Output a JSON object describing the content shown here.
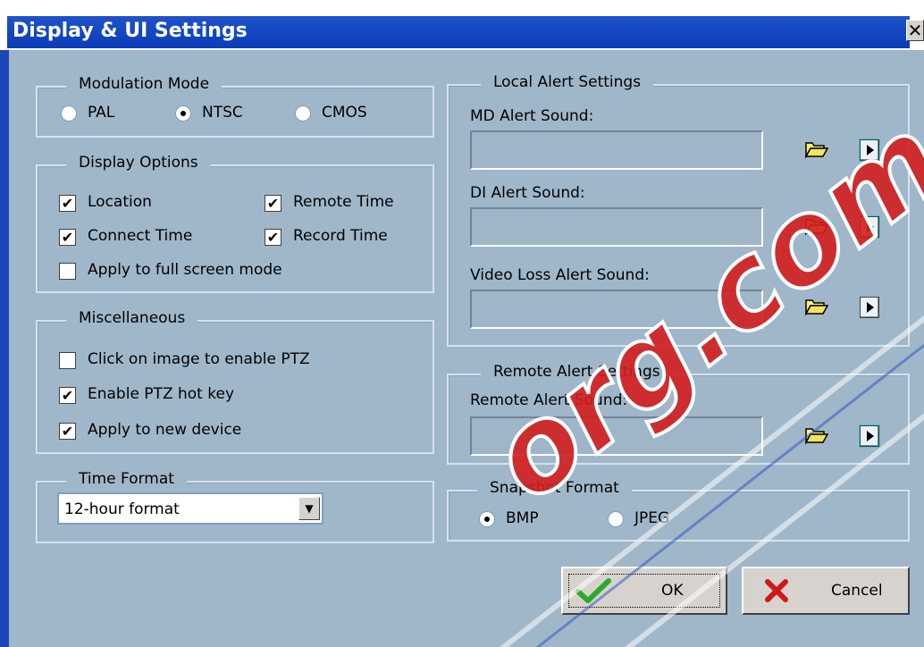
{
  "window": {
    "title": "Display & UI Settings",
    "close_glyph": "✕"
  },
  "modulation": {
    "legend": "Modulation Mode",
    "options": [
      {
        "label": "PAL",
        "selected": false
      },
      {
        "label": "NTSC",
        "selected": true
      },
      {
        "label": "CMOS",
        "selected": false
      }
    ]
  },
  "display_options": {
    "legend": "Display Options",
    "location": {
      "label": "Location",
      "checked": true
    },
    "remote_time": {
      "label": "Remote Time",
      "checked": true
    },
    "connect_time": {
      "label": "Connect Time",
      "checked": true
    },
    "record_time": {
      "label": "Record Time",
      "checked": true
    },
    "full_screen": {
      "label": "Apply to full screen mode",
      "checked": false
    }
  },
  "misc": {
    "legend": "Miscellaneous",
    "ptz_click": {
      "label": "Click on image to enable PTZ",
      "checked": false
    },
    "ptz_hotkey": {
      "label": "Enable PTZ hot key",
      "checked": true
    },
    "new_device": {
      "label": "Apply to new device",
      "checked": true
    }
  },
  "time_format": {
    "legend": "Time Format",
    "selected": "12-hour format"
  },
  "local_alert": {
    "legend": "Local Alert Settings",
    "md_label": "MD Alert Sound:",
    "md_value": "",
    "di_label": "DI Alert Sound:",
    "di_value": "",
    "vl_label": "Video Loss Alert Sound:",
    "vl_value": ""
  },
  "remote_alert": {
    "legend": "Remote Alert Settings",
    "label": "Remote Alert Sound:",
    "value": ""
  },
  "snapshot": {
    "legend": "Snapshot Format",
    "options": [
      {
        "label": "BMP",
        "selected": true
      },
      {
        "label": "JPEG",
        "selected": false
      }
    ]
  },
  "buttons": {
    "ok": "OK",
    "cancel": "Cancel"
  },
  "icons": {
    "folder": "folder-open-icon",
    "play": "play-icon",
    "ok": "checkmark-icon",
    "cancel": "x-icon",
    "dropdown": "chevron-down-icon"
  },
  "colors": {
    "title_bar": "#0a3cb8",
    "dialog_bg": "#a0b7ca",
    "ok_check": "#2fa82f",
    "cancel_x": "#d01818"
  },
  "watermark": "org.com"
}
